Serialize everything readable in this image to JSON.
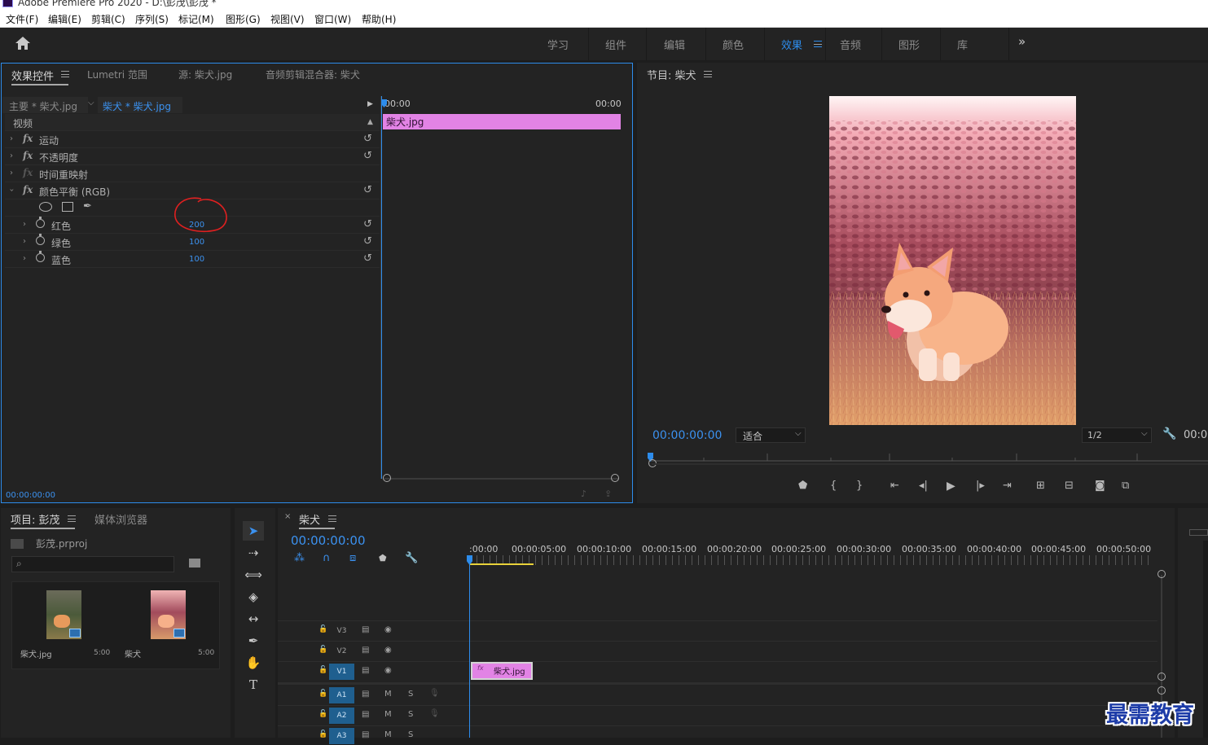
{
  "window": {
    "title": "Adobe Premiere Pro 2020 - D:\\彭茂\\彭茂 *"
  },
  "menu": [
    "文件(F)",
    "编辑(E)",
    "剪辑(C)",
    "序列(S)",
    "标记(M)",
    "图形(G)",
    "视图(V)",
    "窗口(W)",
    "帮助(H)"
  ],
  "workspaces": {
    "items": [
      "学习",
      "组件",
      "编辑",
      "颜色",
      "效果",
      "音频",
      "图形",
      "库"
    ],
    "active": "效果",
    "more": "»"
  },
  "effect_controls": {
    "tabs": [
      "效果控件",
      "Lumetri 范围",
      "源: 柴犬.jpg",
      "音频剪辑混合器: 柴犬"
    ],
    "source_label": "主要 * 柴犬.jpg",
    "sequence_label": "柴犬 * 柴犬.jpg",
    "section_video": "视频",
    "effects": [
      {
        "name": "运动"
      },
      {
        "name": "不透明度"
      },
      {
        "name": "时间重映射"
      },
      {
        "name": "颜色平衡 (RGB)"
      }
    ],
    "params": [
      {
        "name": "红色",
        "value": "200"
      },
      {
        "name": "绿色",
        "value": "100"
      },
      {
        "name": "蓝色",
        "value": "100"
      }
    ],
    "timeline_start": "00:00",
    "timeline_end": "00:00",
    "clip_name": "柴犬.jpg",
    "timecode": "00:00:00:00"
  },
  "program": {
    "title": "节目: 柴犬",
    "timecode": "00:00:00:00",
    "fit_label": "适合",
    "resolution": "1/2",
    "right_time": "00:0"
  },
  "project": {
    "tabs": [
      "项目: 彭茂",
      "媒体浏览器"
    ],
    "file": "彭茂.prproj",
    "items": [
      {
        "name": "柴犬.jpg",
        "duration": "5:00"
      },
      {
        "name": "柴犬",
        "duration": "5:00"
      }
    ]
  },
  "timeline": {
    "title": "柴犬",
    "close": "×",
    "timecode": "00:00:00:00",
    "ruler": [
      ":00:00",
      "00:00:05:00",
      "00:00:10:00",
      "00:00:15:00",
      "00:00:20:00",
      "00:00:25:00",
      "00:00:30:00",
      "00:00:35:00",
      "00:00:40:00",
      "00:00:45:00",
      "00:00:50:00"
    ],
    "video_tracks": [
      "V3",
      "V2",
      "V1"
    ],
    "audio_tracks": [
      "A1",
      "A2",
      "A3"
    ],
    "track_m": "M",
    "track_s": "S",
    "clip": {
      "fx": "fx",
      "name": "柴犬.jpg"
    }
  },
  "watermark": "最需教育",
  "colors": {
    "accent": "#2d8ceb",
    "clip": "#e283e5",
    "annotation": "#e02020"
  }
}
